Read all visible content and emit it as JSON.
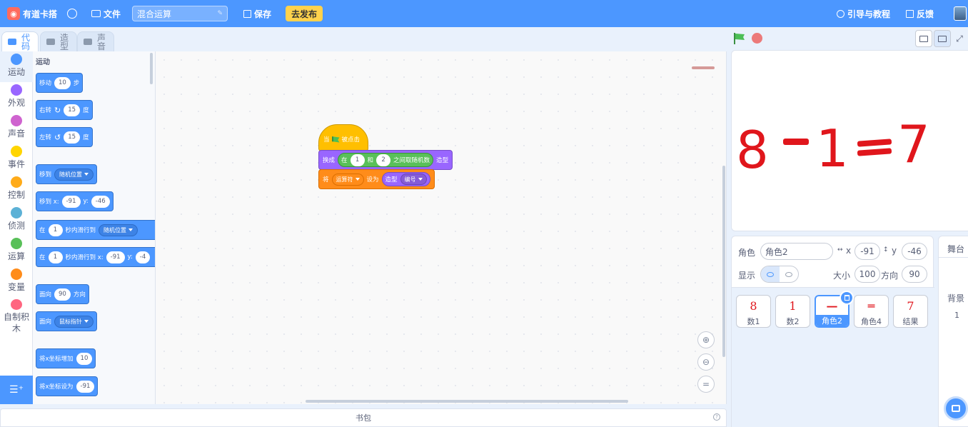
{
  "app": {
    "brand": "有道卡搭",
    "file_menu": "文件",
    "project_title": "混合运算",
    "save_label": "保存",
    "publish_label": "去发布",
    "guide_label": "引导与教程",
    "feedback_label": "反馈",
    "accent_color": "#4c97ff"
  },
  "tabs": [
    {
      "label": "代码",
      "icon": "code-icon",
      "active": true
    },
    {
      "label": "造型",
      "icon": "brush-icon",
      "active": false
    },
    {
      "label": "声音",
      "icon": "speaker-icon",
      "active": false
    }
  ],
  "categories": [
    {
      "label": "运动",
      "color": "#4c97ff"
    },
    {
      "label": "外观",
      "color": "#9966ff"
    },
    {
      "label": "声音",
      "color": "#cf63cf"
    },
    {
      "label": "事件",
      "color": "#ffd500"
    },
    {
      "label": "控制",
      "color": "#ffab19"
    },
    {
      "label": "侦测",
      "color": "#5cb1d6"
    },
    {
      "label": "运算",
      "color": "#59c059"
    },
    {
      "label": "变量",
      "color": "#ff8c1a"
    },
    {
      "label": "自制积木",
      "color": "#ff6680"
    }
  ],
  "palette": {
    "section_title": "运动",
    "move": {
      "label": "移动",
      "steps": "10",
      "unit": "步"
    },
    "turn_right": {
      "label": "右转",
      "degrees": "15",
      "unit": "度"
    },
    "turn_left": {
      "label": "左转",
      "degrees": "15",
      "unit": "度"
    },
    "goto": {
      "label": "移到",
      "target": "随机位置"
    },
    "goto_xy": {
      "label": "移到 x:",
      "x": "-91",
      "y_label": "y:",
      "y": "-46"
    },
    "glide": {
      "prefix": "在",
      "secs": "1",
      "label": "秒内滑行到",
      "target": "随机位置"
    },
    "glide_xy": {
      "prefix": "在",
      "secs": "1",
      "label": "秒内滑行到 x:",
      "x": "-91",
      "y_label": "y:",
      "y": "-4"
    },
    "point_dir": {
      "label": "面向",
      "value": "90",
      "unit": "方向"
    },
    "point_towards": {
      "label": "面向",
      "target": "鼠标指针"
    },
    "change_x": {
      "label": "将x坐标增加",
      "value": "10"
    },
    "set_x": {
      "label": "将x坐标设为",
      "value": "-91"
    }
  },
  "script": {
    "hat": {
      "prefix": "当",
      "suffix": "被点击"
    },
    "switch_costume": {
      "label": "换成",
      "in": "在",
      "from": "1",
      "and": "和",
      "to": "2",
      "random": "之间取随机数",
      "suffix": "造型"
    },
    "set_var": {
      "label": "将",
      "var": "运算符",
      "to": "设为",
      "costume": "造型",
      "prop": "编号"
    }
  },
  "backpack": {
    "label": "书包",
    "help": "?"
  },
  "stage": {
    "expression": [
      {
        "text": "8",
        "kind": "digit"
      },
      {
        "text": "−",
        "kind": "minus"
      },
      {
        "text": "1",
        "kind": "digit"
      },
      {
        "text": "=",
        "kind": "equals"
      },
      {
        "text": "7",
        "kind": "digit"
      }
    ],
    "text_color": "#e0161c"
  },
  "sprite_info": {
    "sprite_label": "角色",
    "sprite_name": "角色2",
    "x_label": "x",
    "x": "-91",
    "y_label": "y",
    "y": "-46",
    "show_label": "显示",
    "size_label": "大小",
    "size": "100",
    "direction_label": "方向",
    "direction": "90"
  },
  "sprites": [
    {
      "name": "数1",
      "glyph": "8",
      "selected": false
    },
    {
      "name": "数2",
      "glyph": "1",
      "selected": false
    },
    {
      "name": "角色2",
      "glyph": "—",
      "selected": true
    },
    {
      "name": "角色4",
      "glyph": "═",
      "selected": false
    },
    {
      "name": "结果",
      "glyph": "7",
      "selected": false
    }
  ],
  "stage_pane": {
    "title": "舞台",
    "backdrop_label": "背景",
    "backdrop_count": "1"
  }
}
